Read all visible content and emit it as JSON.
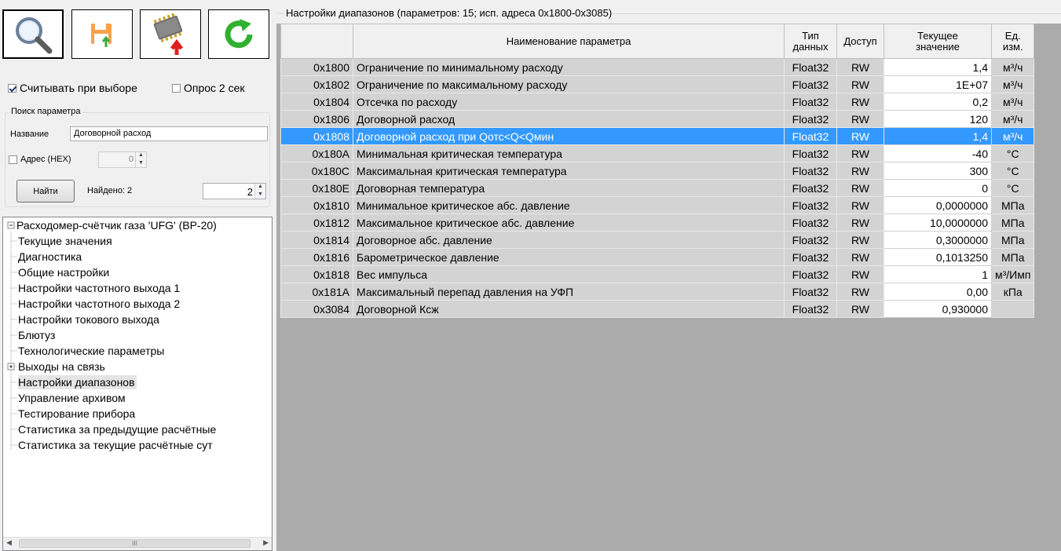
{
  "toolbar": {
    "buttons": [
      {
        "name": "search-button",
        "icon": "magnifier-icon"
      },
      {
        "name": "save-button",
        "icon": "save-upload-icon"
      },
      {
        "name": "write-chip-button",
        "icon": "chip-upload-icon"
      },
      {
        "name": "refresh-button",
        "icon": "refresh-icon"
      }
    ]
  },
  "options": {
    "read_on_select": "Считывать при выборе",
    "poll_2s": "Опрос 2 сек"
  },
  "search": {
    "group_title": "Поиск параметра",
    "name_label": "Название",
    "name_value": "Договорной расход",
    "addr_label": "Адрес (HEX)",
    "addr_value": "0",
    "find_button": "Найти",
    "found_label": "Найдено: 2",
    "found_index": "2"
  },
  "tree": {
    "root": "Расходомер-счётчик газа 'UFG' (ВР-20)",
    "items": [
      "Текущие значения",
      "Диагностика",
      "Общие настройки",
      "Настройки частотного выхода 1",
      "Настройки частотного выхода 2",
      "Настройки токового выхода",
      "Блютуз",
      "Технологические параметры",
      "Выходы на связь",
      "Настройки диапазонов",
      "Управление архивом",
      "Тестирование прибора",
      "Статистика за предыдущие расчётные",
      "Статистика за текущие расчётные сут"
    ],
    "scroll_thumb": "III"
  },
  "grid": {
    "caption": "Настройки диапазонов (параметров: 15; исп. адреса 0x1800-0x3085)",
    "headers": {
      "name": "Наименование параметра",
      "type_1": "Тип",
      "type_2": "данных",
      "access": "Доступ",
      "value_1": "Текущее",
      "value_2": "значение",
      "unit_1": "Ед.",
      "unit_2": "изм."
    },
    "rows": [
      {
        "addr": "0x1800",
        "name": "Ограничение по минимальному расходу",
        "type": "Float32",
        "access": "RW",
        "value": "1,4",
        "unit": "м³/ч"
      },
      {
        "addr": "0x1802",
        "name": "Ограничение по максимальному расходу",
        "type": "Float32",
        "access": "RW",
        "value": "1E+07",
        "unit": "м³/ч"
      },
      {
        "addr": "0x1804",
        "name": "Отсечка по расходу",
        "type": "Float32",
        "access": "RW",
        "value": "0,2",
        "unit": "м³/ч"
      },
      {
        "addr": "0x1806",
        "name": "Договорной расход",
        "type": "Float32",
        "access": "RW",
        "value": "120",
        "unit": "м³/ч"
      },
      {
        "addr": "0x1808",
        "name": "Договорной расход при Qотс<Q<Qмин",
        "type": "Float32",
        "access": "RW",
        "value": "1,4",
        "unit": "м³/ч"
      },
      {
        "addr": "0x180A",
        "name": "Минимальная критическая температура",
        "type": "Float32",
        "access": "RW",
        "value": "-40",
        "unit": "°C"
      },
      {
        "addr": "0x180C",
        "name": "Максимальная критическая температура",
        "type": "Float32",
        "access": "RW",
        "value": "300",
        "unit": "°C"
      },
      {
        "addr": "0x180E",
        "name": "Договорная температура",
        "type": "Float32",
        "access": "RW",
        "value": "0",
        "unit": "°C"
      },
      {
        "addr": "0x1810",
        "name": "Минимальное критическое абс. давление",
        "type": "Float32",
        "access": "RW",
        "value": "0,0000000",
        "unit": "МПа"
      },
      {
        "addr": "0x1812",
        "name": "Максимальное критическое абс. давление",
        "type": "Float32",
        "access": "RW",
        "value": "10,0000000",
        "unit": "МПа"
      },
      {
        "addr": "0x1814",
        "name": "Договорное абс. давление",
        "type": "Float32",
        "access": "RW",
        "value": "0,3000000",
        "unit": "МПа"
      },
      {
        "addr": "0x1816",
        "name": "Барометрическое давление",
        "type": "Float32",
        "access": "RW",
        "value": "0,1013250",
        "unit": "МПа"
      },
      {
        "addr": "0x1818",
        "name": "Вес импульса",
        "type": "Float32",
        "access": "RW",
        "value": "1",
        "unit": "м³/Имп"
      },
      {
        "addr": "0x181A",
        "name": "Максимальный перепад давления на УФП",
        "type": "Float32",
        "access": "RW",
        "value": "0,00",
        "unit": "кПа"
      },
      {
        "addr": "0x3084",
        "name": "Договорной Ксж",
        "type": "Float32",
        "access": "RW",
        "value": "0,930000",
        "unit": ""
      }
    ]
  },
  "colors": {
    "selection": "#3399ff",
    "empty_area": "#ababab",
    "row_bg": "#d3d3d3"
  }
}
